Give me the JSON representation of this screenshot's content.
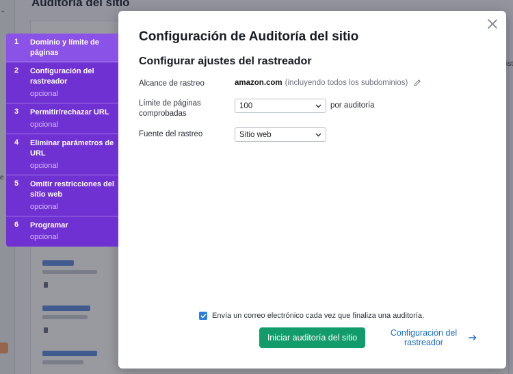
{
  "background": {
    "page_title": "Auditoría del sitio",
    "edge_left": "e",
    "edge_right": "ist"
  },
  "modal": {
    "title": "Configuración de Auditoría del sitio",
    "subtitle": "Configurar ajustes del rastreador",
    "scope": {
      "label": "Alcance de rastreo",
      "domain": "amazon.com",
      "note": "(incluyendo todos los subdominios)"
    },
    "page_limit": {
      "label": "Límite de páginas comprobadas",
      "value": "100",
      "suffix": "por auditoría"
    },
    "crawl_source": {
      "label": "Fuente del rastreo",
      "value": "Sitio web"
    },
    "email_checkbox": {
      "checked": true,
      "label": "Envía un correo electrónico cada vez que finaliza una auditoría."
    },
    "start_button": "Iniciar auditoría del sitio",
    "crawler_settings_link": "Configuración del rastreador"
  },
  "steps": [
    {
      "num": "1",
      "title": "Dominio y límite de páginas",
      "optional": "",
      "active": true
    },
    {
      "num": "2",
      "title": "Configuración del rastreador",
      "optional": "opcional",
      "active": false
    },
    {
      "num": "3",
      "title": "Permitir/rechazar URL",
      "optional": "opcional",
      "active": false
    },
    {
      "num": "4",
      "title": "Eliminar parámetros de URL",
      "optional": "opcional",
      "active": false
    },
    {
      "num": "5",
      "title": "Omitir restricciones del sitio web",
      "optional": "opcional",
      "active": false
    },
    {
      "num": "6",
      "title": "Programar",
      "optional": "opcional",
      "active": false
    }
  ],
  "colors": {
    "sidebar": "#7031d3",
    "sidebar_active": "#8a52e6",
    "primary_button": "#139c6b",
    "link": "#1a6bc6",
    "checkbox": "#2b7de1"
  }
}
